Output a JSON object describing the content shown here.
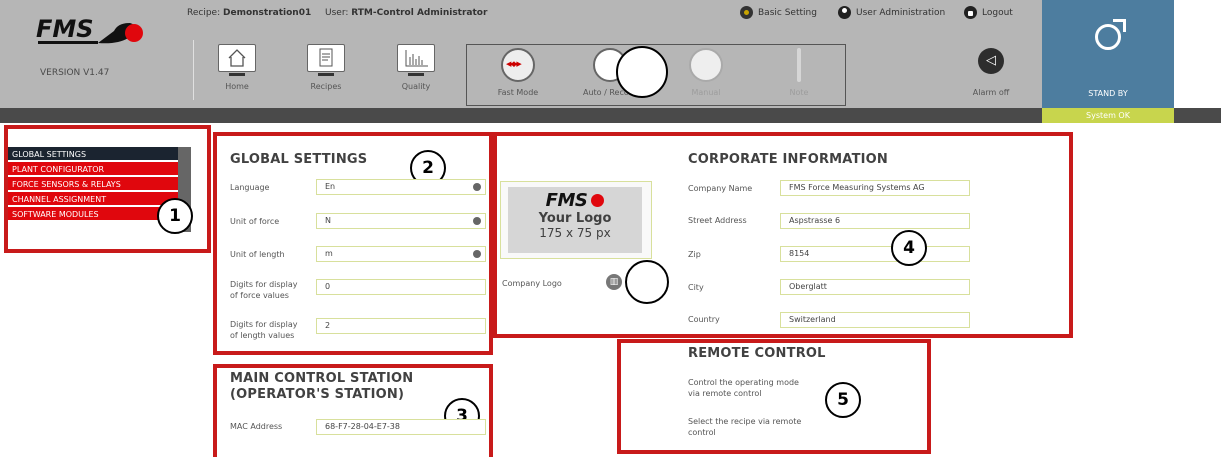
{
  "header": {
    "brand": "FMS",
    "version": "VERSION V1.47",
    "recipe_label": "Recipe:",
    "recipe_value": "Demonstration01",
    "user_label": "User:",
    "user_value": "RTM-Control Administrator",
    "nav": {
      "basic_setting": "Basic Setting",
      "user_administration": "User Administration",
      "logout": "Logout"
    },
    "toolbar": {
      "home": "Home",
      "recipes": "Recipes",
      "quality": "Quality",
      "fast_mode": "Fast Mode",
      "auto_record": "Auto / Record",
      "manual": "Manual",
      "note": "Note",
      "alarm_off": "Alarm off"
    },
    "status": {
      "mode": "STAND BY",
      "system": "System OK"
    }
  },
  "sidebar": {
    "items": [
      {
        "label": "GLOBAL SETTINGS",
        "active": true
      },
      {
        "label": "PLANT CONFIGURATOR",
        "active": false
      },
      {
        "label": "FORCE SENSORS & RELAYS",
        "active": false
      },
      {
        "label": "CHANNEL ASSIGNMENT",
        "active": false
      },
      {
        "label": "SOFTWARE MODULES",
        "active": false
      }
    ]
  },
  "global_settings": {
    "title": "GLOBAL SETTINGS",
    "language_label": "Language",
    "language_value": "En",
    "unit_force_label": "Unit of force",
    "unit_force_value": "N",
    "unit_length_label": "Unit of length",
    "unit_length_value": "m",
    "digits_force_label_1": "Digits for display",
    "digits_force_label_2": "of force values",
    "digits_force_value": "0",
    "digits_length_label_1": "Digits for display",
    "digits_length_label_2": "of length values",
    "digits_length_value": "2"
  },
  "main_control": {
    "title_1": "MAIN CONTROL STATION",
    "title_2": "(OPERATOR'S STATION)",
    "mac_label": "MAC Address",
    "mac_value": "68-F7-28-04-E7-38"
  },
  "corporate": {
    "title": "CORPORATE INFORMATION",
    "logo_brand": "FMS",
    "logo_text": "Your Logo",
    "logo_size": "175 x 75 px",
    "company_logo_label": "Company Logo",
    "company_name_label": "Company Name",
    "company_name_value": "FMS Force Measuring Systems AG",
    "street_label": "Street Address",
    "street_value": "Aspstrasse 6",
    "zip_label": "Zip",
    "zip_value": "8154",
    "city_label": "City",
    "city_value": "Oberglatt",
    "country_label": "Country",
    "country_value": "Switzerland"
  },
  "remote_control": {
    "title": "REMOTE CONTROL",
    "line1a": "Control the operating mode",
    "line1b": "via remote control",
    "line2a": "Select the recipe via remote",
    "line2b": "control"
  },
  "callouts": [
    "1",
    "2",
    "3",
    "4",
    "5"
  ],
  "colors": {
    "header_bg": "#b6b6b6",
    "standby_bg": "#4d7d9f",
    "system_ok_bg": "#c8d54d",
    "sidebar_active": "#1b2430",
    "sidebar_item": "#e0070d",
    "annotation_red": "#c81a1a",
    "field_border": "#d8e09c"
  }
}
